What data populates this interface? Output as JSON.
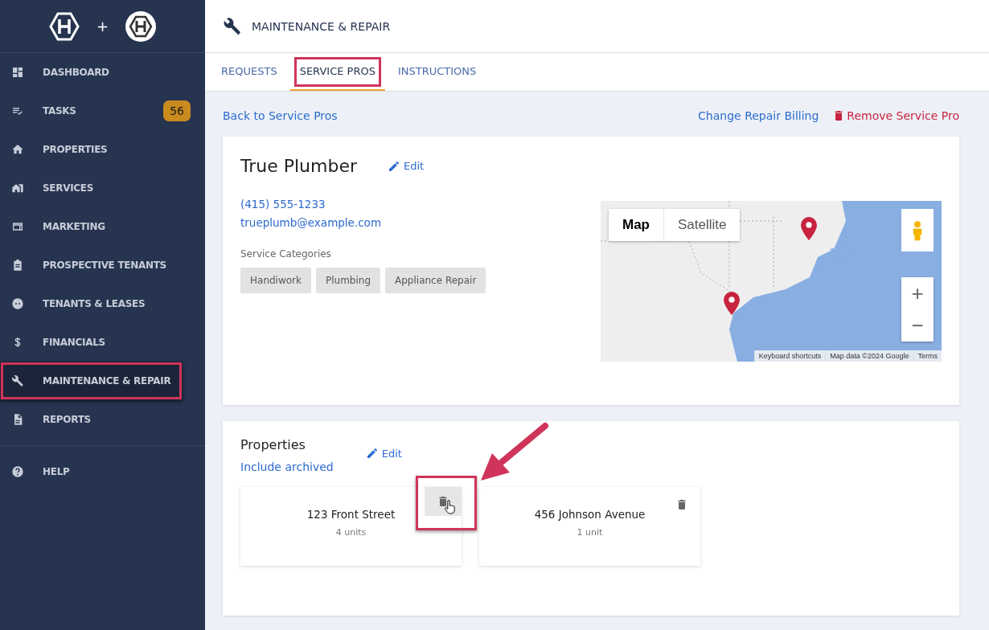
{
  "sidebar": {
    "logo_plus": "+",
    "items": [
      {
        "label": "DASHBOARD",
        "selected": false,
        "highlighted": false
      },
      {
        "label": "TASKS",
        "selected": false,
        "highlighted": false,
        "badge": "56"
      },
      {
        "label": "PROPERTIES",
        "selected": false,
        "highlighted": false
      },
      {
        "label": "SERVICES",
        "selected": false,
        "highlighted": false
      },
      {
        "label": "MARKETING",
        "selected": false,
        "highlighted": false
      },
      {
        "label": "PROSPECTIVE TENANTS",
        "selected": false,
        "highlighted": false
      },
      {
        "label": "TENANTS & LEASES",
        "selected": false,
        "highlighted": false
      },
      {
        "label": "FINANCIALS",
        "selected": false,
        "highlighted": false
      },
      {
        "label": "MAINTENANCE & REPAIR",
        "selected": true,
        "highlighted": true
      },
      {
        "label": "REPORTS",
        "selected": false,
        "highlighted": false
      }
    ],
    "footer_items": [
      {
        "label": "HELP",
        "selected": false
      }
    ]
  },
  "header": {
    "title": "MAINTENANCE & REPAIR"
  },
  "tabs": [
    {
      "label": "REQUESTS",
      "selected": false,
      "highlighted": false
    },
    {
      "label": "SERVICE PROS",
      "selected": true,
      "highlighted": true
    },
    {
      "label": "INSTRUCTIONS",
      "selected": false,
      "highlighted": false
    }
  ],
  "actions": {
    "back": "Back to Service Pros",
    "billing": "Change Repair Billing",
    "remove": "Remove Service Pro"
  },
  "pro": {
    "name": "True Plumber",
    "edit": "Edit",
    "phone": "(415) 555-1233",
    "email": "trueplumb@example.com",
    "categories_label": "Service Categories",
    "categories": [
      "Handiwork",
      "Plumbing",
      "Appliance Repair"
    ]
  },
  "map": {
    "types": [
      {
        "label": "Map",
        "selected": true
      },
      {
        "label": "Satellite",
        "selected": false
      }
    ],
    "zoom_in": "+",
    "zoom_out": "−",
    "attribution": [
      "Keyboard shortcuts",
      "Map data ©2024 Google",
      "Terms"
    ]
  },
  "properties": {
    "title": "Properties",
    "edit": "Edit",
    "include_archived": "Include archived",
    "items": [
      {
        "name": "123 Front Street",
        "units": "4 units",
        "hovered": true,
        "highlighted": true
      },
      {
        "name": "456 Johnson Avenue",
        "units": "1 unit",
        "hovered": false,
        "highlighted": false
      }
    ]
  }
}
